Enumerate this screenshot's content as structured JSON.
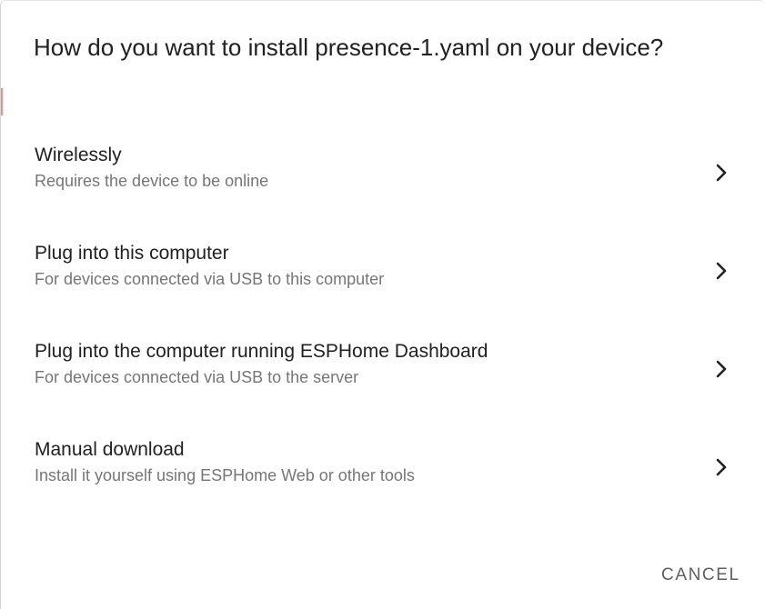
{
  "dialog": {
    "title": "How do you want to install presence-1.yaml on your device?"
  },
  "options": [
    {
      "title": "Wirelessly",
      "description": "Requires the device to be online",
      "icon": "chevron-right-icon"
    },
    {
      "title": "Plug into this computer",
      "description": "For devices connected via USB to this computer",
      "icon": "chevron-right-icon"
    },
    {
      "title": "Plug into the computer running ESPHome Dashboard",
      "description": "For devices connected via USB to the server",
      "icon": "chevron-right-icon"
    },
    {
      "title": "Manual download",
      "description": "Install it yourself using ESPHome Web or other tools",
      "icon": "chevron-right-icon"
    }
  ],
  "actions": {
    "cancel_label": "CANCEL"
  },
  "colors": {
    "text_primary": "#212121",
    "text_secondary": "#767676",
    "button_text": "#5f5f5f"
  }
}
